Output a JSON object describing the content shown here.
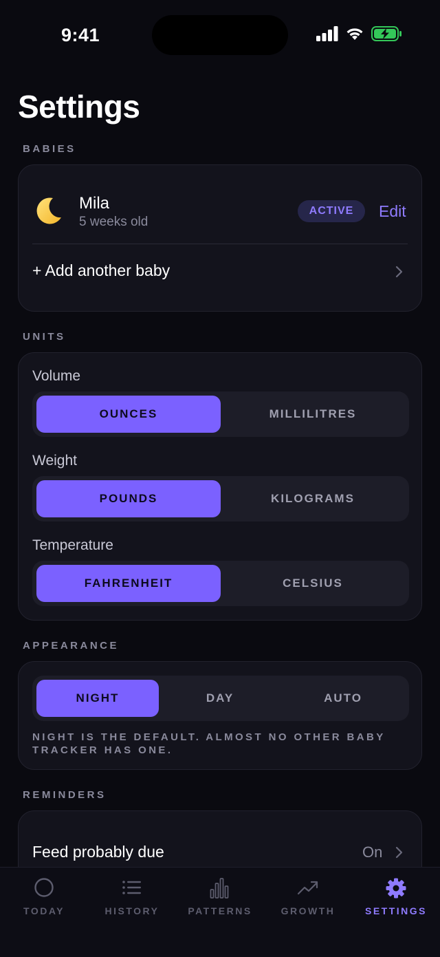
{
  "status_bar": {
    "time": "9:41"
  },
  "page": {
    "title": "Settings"
  },
  "babies": {
    "section_label": "BABIES",
    "baby": {
      "icon": "moon-icon",
      "name": "Mila",
      "age": "5 weeks old",
      "badge": "ACTIVE",
      "edit_label": "Edit"
    },
    "add_label": "+ Add another baby"
  },
  "units": {
    "section_label": "UNITS",
    "volume": {
      "label": "Volume",
      "options": [
        "OUNCES",
        "MILLILITRES"
      ],
      "selected": "OUNCES"
    },
    "weight": {
      "label": "Weight",
      "options": [
        "POUNDS",
        "KILOGRAMS"
      ],
      "selected": "POUNDS"
    },
    "temperature": {
      "label": "Temperature",
      "options": [
        "FAHRENHEIT",
        "CELSIUS"
      ],
      "selected": "FAHRENHEIT"
    }
  },
  "appearance": {
    "section_label": "APPEARANCE",
    "options": [
      "NIGHT",
      "DAY",
      "AUTO"
    ],
    "selected": "NIGHT",
    "note": "NIGHT IS THE DEFAULT. ALMOST NO OTHER BABY TRACKER HAS ONE."
  },
  "reminders": {
    "section_label": "REMINDERS",
    "items": [
      {
        "label": "Feed probably due",
        "value": "On"
      }
    ]
  },
  "tab_bar": {
    "tabs": [
      {
        "label": "TODAY",
        "icon": "circle-icon"
      },
      {
        "label": "HISTORY",
        "icon": "list-icon"
      },
      {
        "label": "PATTERNS",
        "icon": "bar-chart-icon"
      },
      {
        "label": "GROWTH",
        "icon": "trend-up-icon"
      },
      {
        "label": "SETTINGS",
        "icon": "gear-icon"
      }
    ],
    "active": "SETTINGS"
  },
  "colors": {
    "accent": "#7b61ff",
    "accent_text": "#8f7bff",
    "background": "#0a0a10",
    "card": "#13131c",
    "battery": "#34c759"
  }
}
